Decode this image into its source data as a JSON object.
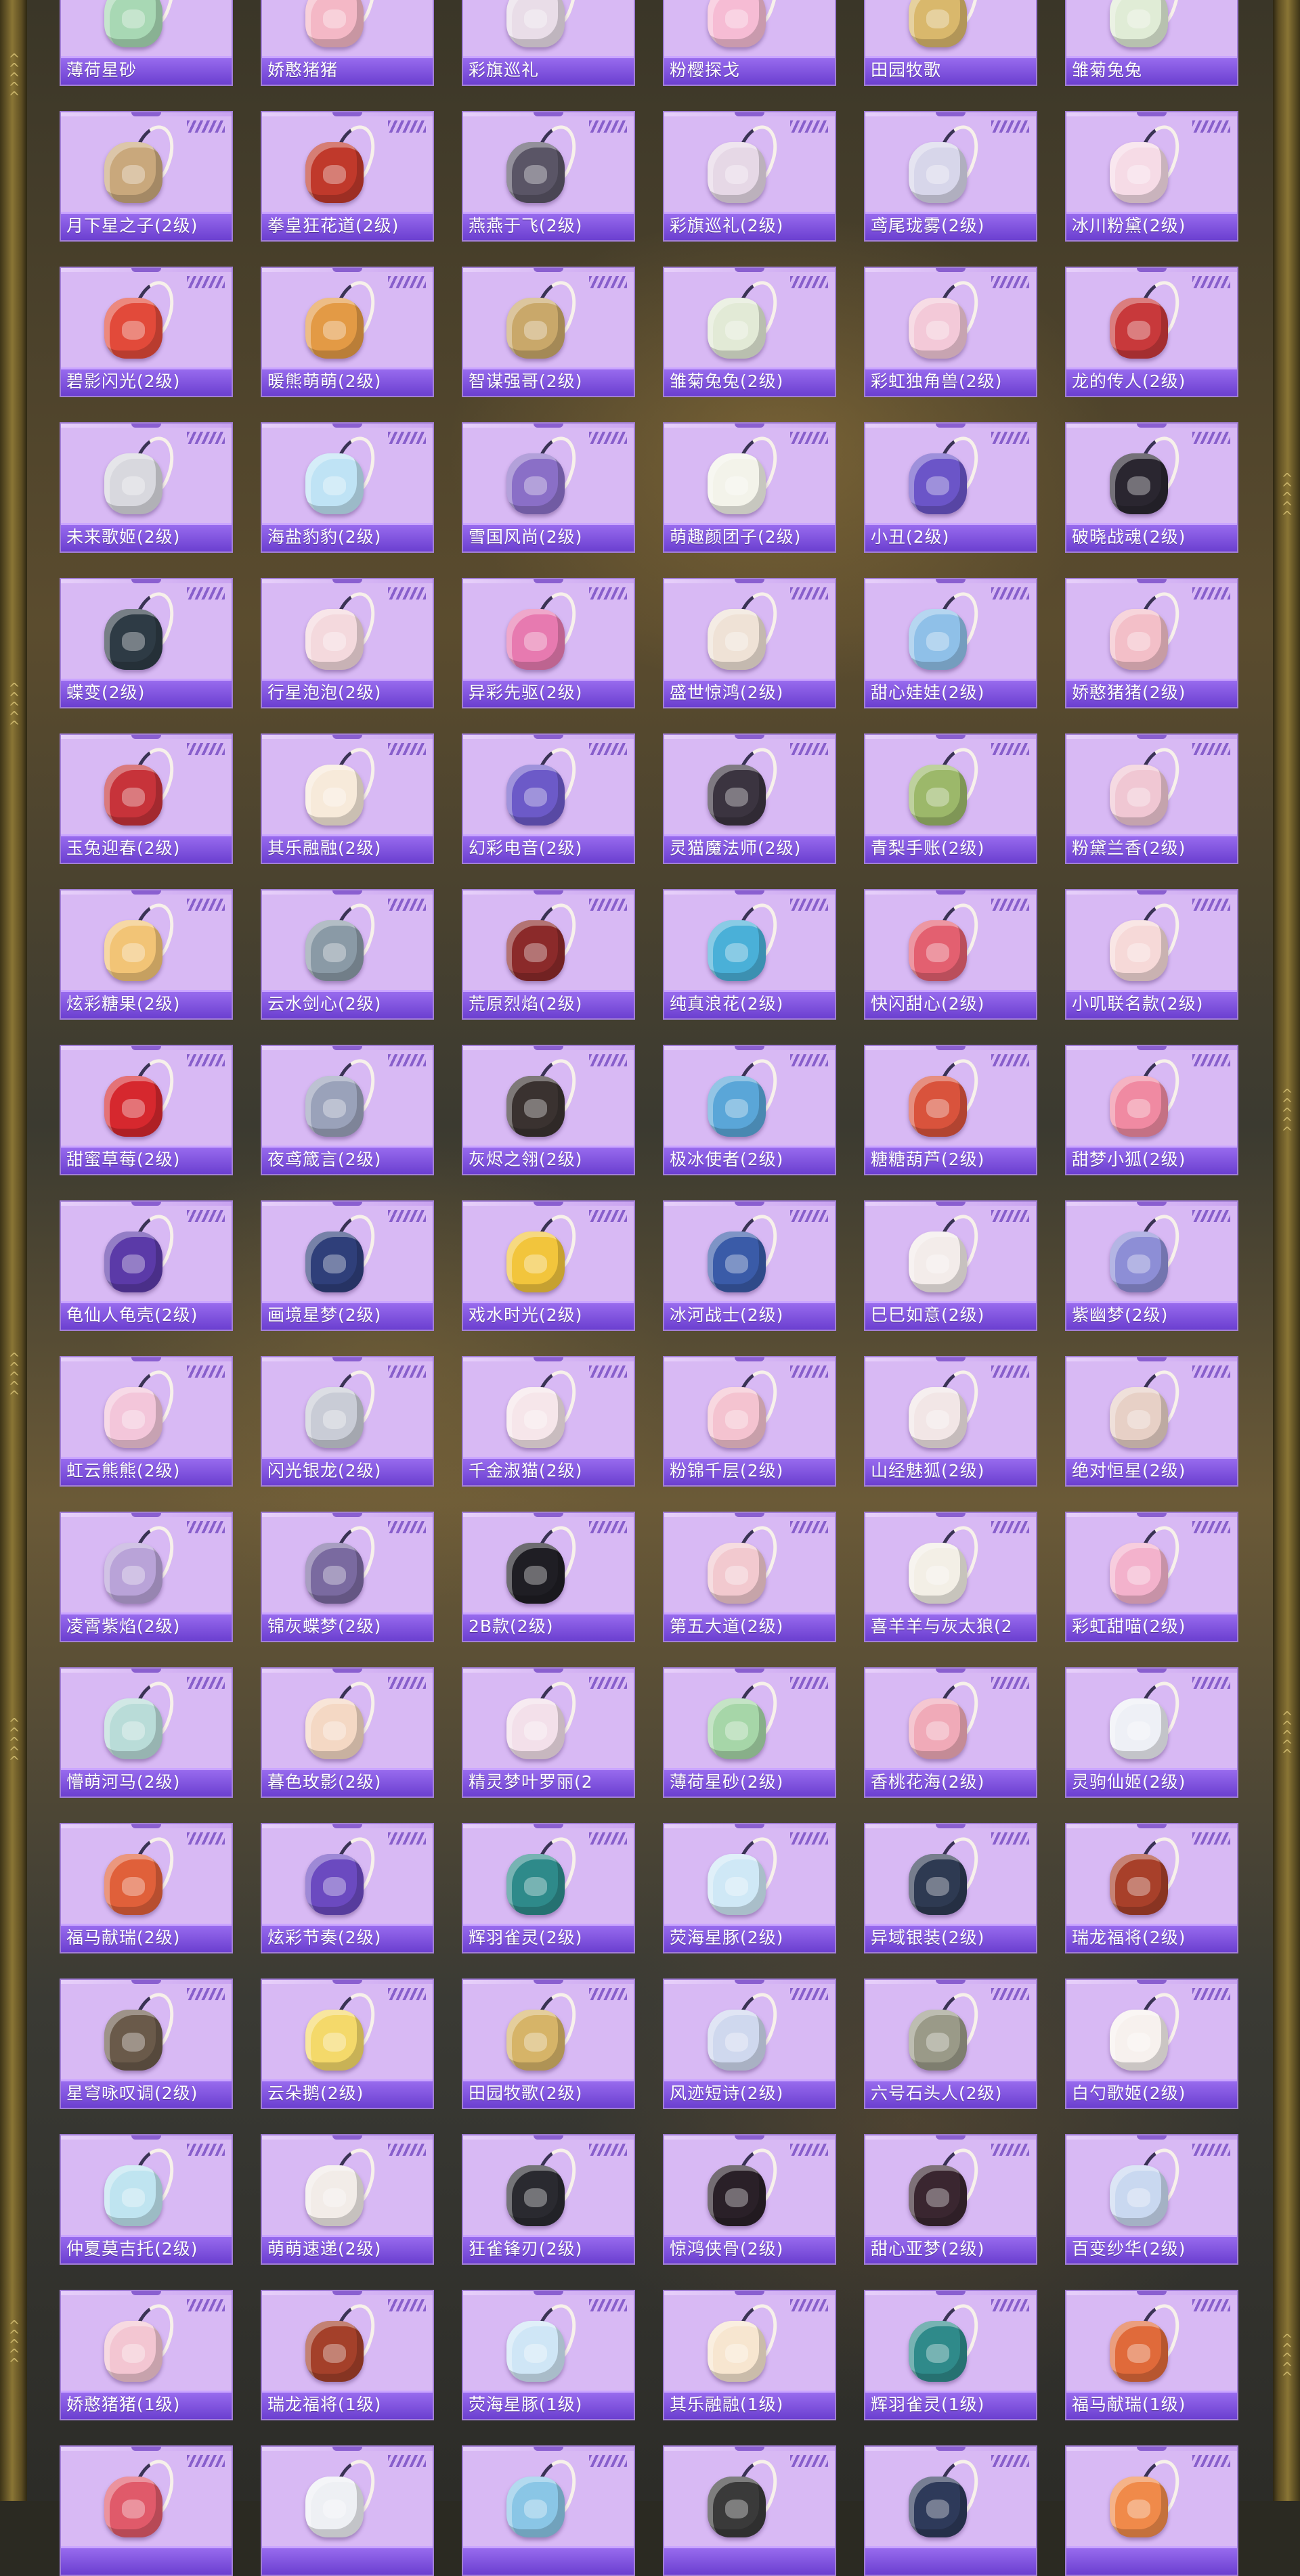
{
  "items": [
    {
      "name": "薄荷星砂",
      "icon": "backpack-icon",
      "color": "#a8d8b4"
    },
    {
      "name": "娇憨猪猪",
      "icon": "backpack-icon",
      "color": "#f4b8c6"
    },
    {
      "name": "彩旗巡礼",
      "icon": "backpack-icon",
      "color": "#e9dde8"
    },
    {
      "name": "粉樱探戈",
      "icon": "backpack-icon",
      "color": "#f6bcd4"
    },
    {
      "name": "田园牧歌",
      "icon": "backpack-icon",
      "color": "#d9b86c"
    },
    {
      "name": "雏菊兔兔",
      "icon": "backpack-icon",
      "color": "#e0ecd6"
    },
    {
      "name": "月下星之子(2级)",
      "icon": "backpack-icon",
      "color": "#c9a87c"
    },
    {
      "name": "拳皇狂花道(2级)",
      "icon": "backpack-icon",
      "color": "#c0392b"
    },
    {
      "name": "燕燕于飞(2级)",
      "icon": "backpack-icon",
      "color": "#5a5566"
    },
    {
      "name": "彩旗巡礼(2级)",
      "icon": "backpack-icon",
      "color": "#e6d8e6"
    },
    {
      "name": "鸢尾珑雾(2级)",
      "icon": "backpack-icon",
      "color": "#d7d6ea"
    },
    {
      "name": "冰川粉黛(2级)",
      "icon": "backpack-icon",
      "color": "#f6dbe6"
    },
    {
      "name": "碧影闪光(2级)",
      "icon": "backpack-icon",
      "color": "#e24a3a"
    },
    {
      "name": "暖熊萌萌(2级)",
      "icon": "backpack-icon",
      "color": "#e39a45"
    },
    {
      "name": "智谋强哥(2级)",
      "icon": "backpack-icon",
      "color": "#c9a86a"
    },
    {
      "name": "雏菊兔兔(2级)",
      "icon": "backpack-icon",
      "color": "#e2ead6"
    },
    {
      "name": "彩虹独角兽(2级)",
      "icon": "backpack-icon",
      "color": "#f3c9d8"
    },
    {
      "name": "龙的传人(2级)",
      "icon": "backpack-icon",
      "color": "#c8393b"
    },
    {
      "name": "未来歌姬(2级)",
      "icon": "backpack-icon",
      "color": "#d8d8de"
    },
    {
      "name": "海盐豹豹(2级)",
      "icon": "backpack-icon",
      "color": "#bfe3f5"
    },
    {
      "name": "雪国风尚(2级)",
      "icon": "backpack-icon",
      "color": "#8a6fc7"
    },
    {
      "name": "萌趣颜团子(2级)",
      "icon": "backpack-icon",
      "color": "#f3f3ea"
    },
    {
      "name": "小丑(2级)",
      "icon": "backpack-icon",
      "color": "#6b55c8"
    },
    {
      "name": "破晓战魂(2级)",
      "icon": "backpack-icon",
      "color": "#2a2630"
    },
    {
      "name": "蝶变(2级)",
      "icon": "backpack-icon",
      "color": "#2e3b45"
    },
    {
      "name": "行星泡泡(2级)",
      "icon": "backpack-icon",
      "color": "#f4d9dd"
    },
    {
      "name": "异彩先驱(2级)",
      "icon": "backpack-icon",
      "color": "#e77ab0"
    },
    {
      "name": "盛世惊鸿(2级)",
      "icon": "backpack-icon",
      "color": "#efe2d6"
    },
    {
      "name": "甜心娃娃(2级)",
      "icon": "backpack-icon",
      "color": "#8fc0e8"
    },
    {
      "name": "娇憨猪猪(2级)",
      "icon": "backpack-icon",
      "color": "#f3bfc8"
    },
    {
      "name": "玉兔迎春(2级)",
      "icon": "backpack-icon",
      "color": "#c7333a"
    },
    {
      "name": "其乐融融(2级)",
      "icon": "backpack-icon",
      "color": "#f7eada"
    },
    {
      "name": "幻彩电音(2级)",
      "icon": "backpack-icon",
      "color": "#6c5ac8"
    },
    {
      "name": "灵猫魔法师(2级)",
      "icon": "backpack-icon",
      "color": "#3b3440"
    },
    {
      "name": "青梨手账(2级)",
      "icon": "backpack-icon",
      "color": "#9cb86a"
    },
    {
      "name": "粉黛兰香(2级)",
      "icon": "backpack-icon",
      "color": "#f0c7d3"
    },
    {
      "name": "炫彩糖果(2级)",
      "icon": "backpack-icon",
      "color": "#f2c476"
    },
    {
      "name": "云水剑心(2级)",
      "icon": "backpack-icon",
      "color": "#8a9aa6"
    },
    {
      "name": "荒原烈焰(2级)",
      "icon": "backpack-icon",
      "color": "#8b2a2a"
    },
    {
      "name": "纯真浪花(2级)",
      "icon": "backpack-icon",
      "color": "#4ab0d8"
    },
    {
      "name": "快闪甜心(2级)",
      "icon": "backpack-icon",
      "color": "#e36070"
    },
    {
      "name": "小叽联名款(2级)",
      "icon": "backpack-icon",
      "color": "#f6d9d8"
    },
    {
      "name": "甜蜜草莓(2级)",
      "icon": "backpack-icon",
      "color": "#d6282e"
    },
    {
      "name": "夜鸢箴言(2级)",
      "icon": "backpack-icon",
      "color": "#9aa2ba"
    },
    {
      "name": "灰烬之翎(2级)",
      "icon": "backpack-icon",
      "color": "#3a3230"
    },
    {
      "name": "极冰使者(2级)",
      "icon": "backpack-icon",
      "color": "#5aa6d8"
    },
    {
      "name": "糖糖葫芦(2级)",
      "icon": "backpack-icon",
      "color": "#d9533c"
    },
    {
      "name": "甜梦小狐(2级)",
      "icon": "backpack-icon",
      "color": "#f08aa2"
    },
    {
      "name": "龟仙人龟壳(2级)",
      "icon": "backpack-icon",
      "color": "#5b3aa8"
    },
    {
      "name": "画境星梦(2级)",
      "icon": "backpack-icon",
      "color": "#2f3f7a"
    },
    {
      "name": "戏水时光(2级)",
      "icon": "backpack-icon",
      "color": "#f2c53c"
    },
    {
      "name": "冰河战士(2级)",
      "icon": "backpack-icon",
      "color": "#3a5ba8"
    },
    {
      "name": "巳巳如意(2级)",
      "icon": "backpack-icon",
      "color": "#f3ecea"
    },
    {
      "name": "紫幽梦(2级)",
      "icon": "backpack-icon",
      "color": "#8d8ed6"
    },
    {
      "name": "虹云熊熊(2级)",
      "icon": "backpack-icon",
      "color": "#f3c6da"
    },
    {
      "name": "闪光银龙(2级)",
      "icon": "backpack-icon",
      "color": "#c9ccd6"
    },
    {
      "name": "千金淑猫(2级)",
      "icon": "backpack-icon",
      "color": "#f6e6ea"
    },
    {
      "name": "粉锦千层(2级)",
      "icon": "backpack-icon",
      "color": "#f4c3d0"
    },
    {
      "name": "山经魅狐(2级)",
      "icon": "backpack-icon",
      "color": "#f2e6e6"
    },
    {
      "name": "绝对恒星(2级)",
      "icon": "backpack-icon",
      "color": "#e7d0c6"
    },
    {
      "name": "凌霄紫焰(2级)",
      "icon": "backpack-icon",
      "color": "#b9a3d8"
    },
    {
      "name": "锦灰蝶梦(2级)",
      "icon": "backpack-icon",
      "color": "#7a6aa0"
    },
    {
      "name": "2B款(2级)",
      "icon": "backpack-icon",
      "color": "#1f1e24"
    },
    {
      "name": "第五大道(2级)",
      "icon": "backpack-icon",
      "color": "#f2c9cf"
    },
    {
      "name": "喜羊羊与灰太狼(2",
      "icon": "backpack-icon",
      "color": "#f3efe6"
    },
    {
      "name": "彩虹甜喵(2级)",
      "icon": "backpack-icon",
      "color": "#f3b2cc"
    },
    {
      "name": "懵萌河马(2级)",
      "icon": "backpack-icon",
      "color": "#b9dcd8"
    },
    {
      "name": "暮色玫影(2级)",
      "icon": "backpack-icon",
      "color": "#f4d8c4"
    },
    {
      "name": "精灵梦叶罗丽(2",
      "icon": "backpack-icon",
      "color": "#f3e0ea"
    },
    {
      "name": "薄荷星砂(2级)",
      "icon": "backpack-icon",
      "color": "#a6d6a8"
    },
    {
      "name": "香桃花海(2级)",
      "icon": "backpack-icon",
      "color": "#f0aab8"
    },
    {
      "name": "灵驹仙姬(2级)",
      "icon": "backpack-icon",
      "color": "#eef0f6"
    },
    {
      "name": "福马献瑞(2级)",
      "icon": "backpack-icon",
      "color": "#e0603a"
    },
    {
      "name": "炫彩节奏(2级)",
      "icon": "backpack-icon",
      "color": "#6b4ac0"
    },
    {
      "name": "辉羽雀灵(2级)",
      "icon": "backpack-icon",
      "color": "#2e8a8a"
    },
    {
      "name": "荧海星豚(2级)",
      "icon": "backpack-icon",
      "color": "#cfe8f6"
    },
    {
      "name": "异域银装(2级)",
      "icon": "backpack-icon",
      "color": "#2e3a52"
    },
    {
      "name": "瑞龙福将(2级)",
      "icon": "backpack-icon",
      "color": "#a8402a"
    },
    {
      "name": "星穹咏叹调(2级)",
      "icon": "backpack-icon",
      "color": "#6a5a4a"
    },
    {
      "name": "云朵鹅(2级)",
      "icon": "backpack-icon",
      "color": "#f4d96a"
    },
    {
      "name": "田园牧歌(2级)",
      "icon": "backpack-icon",
      "color": "#d6b468"
    },
    {
      "name": "风迹短诗(2级)",
      "icon": "backpack-icon",
      "color": "#cfd8ee"
    },
    {
      "name": "六号石头人(2级)",
      "icon": "backpack-icon",
      "color": "#9a9a88"
    },
    {
      "name": "白勺歌姬(2级)",
      "icon": "backpack-icon",
      "color": "#f7f1ee"
    },
    {
      "name": "仲夏莫吉托(2级)",
      "icon": "backpack-icon",
      "color": "#bfe4f0"
    },
    {
      "name": "萌萌速递(2级)",
      "icon": "backpack-icon",
      "color": "#f2ece8"
    },
    {
      "name": "狂雀锋刃(2级)",
      "icon": "backpack-icon",
      "color": "#2a2a30"
    },
    {
      "name": "惊鸿侠骨(2级)",
      "icon": "backpack-icon",
      "color": "#2a2028"
    },
    {
      "name": "甜心亚梦(2级)",
      "icon": "backpack-icon",
      "color": "#3a2630"
    },
    {
      "name": "百变纱华(2级)",
      "icon": "backpack-icon",
      "color": "#c9d8f0"
    },
    {
      "name": "娇憨猪猪(1级)",
      "icon": "backpack-icon",
      "color": "#f3c6d2"
    },
    {
      "name": "瑞龙福将(1级)",
      "icon": "backpack-icon",
      "color": "#a4402a"
    },
    {
      "name": "荧海星豚(1级)",
      "icon": "backpack-icon",
      "color": "#cfe6f6"
    },
    {
      "name": "其乐融融(1级)",
      "icon": "backpack-icon",
      "color": "#f7e6d0"
    },
    {
      "name": "辉羽雀灵(1级)",
      "icon": "backpack-icon",
      "color": "#2f8a8a"
    },
    {
      "name": "福马献瑞(1级)",
      "icon": "backpack-icon",
      "color": "#e06a3a"
    },
    {
      "name": "",
      "icon": "backpack-icon",
      "color": "#e05a6a"
    },
    {
      "name": "",
      "icon": "backpack-icon",
      "color": "#eef0f4"
    },
    {
      "name": "",
      "icon": "backpack-icon",
      "color": "#8ac6e6"
    },
    {
      "name": "",
      "icon": "backpack-icon",
      "color": "#3a3a3a"
    },
    {
      "name": "",
      "icon": "backpack-icon",
      "color": "#2e3a5a"
    },
    {
      "name": "",
      "icon": "backpack-icon",
      "color": "#f08a4a"
    }
  ]
}
